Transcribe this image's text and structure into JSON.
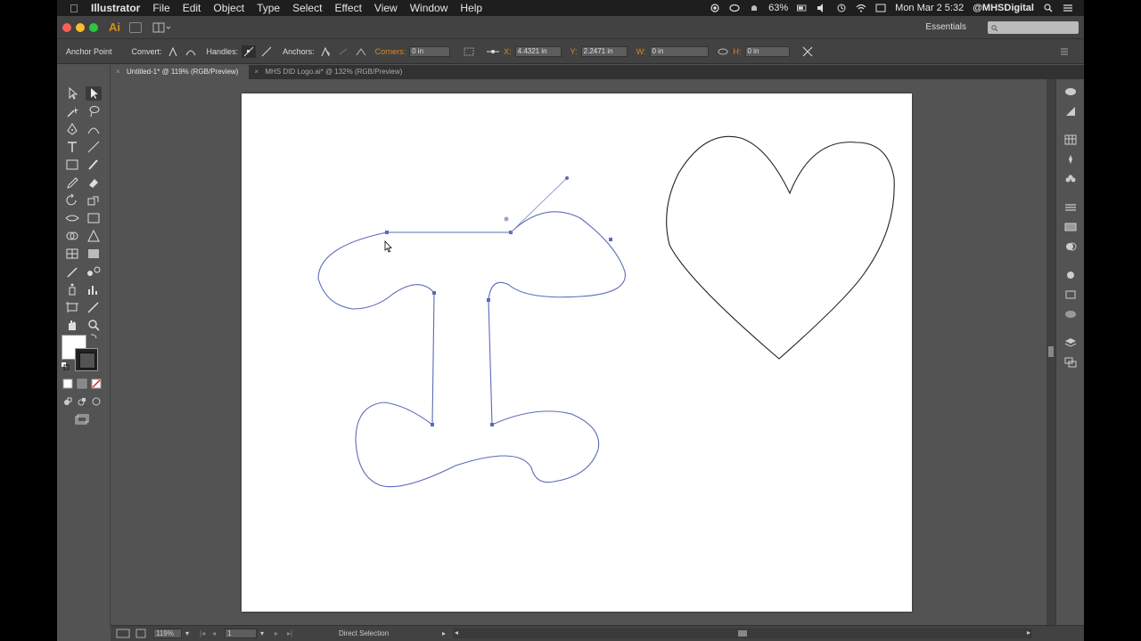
{
  "menubar": {
    "app_name": "Illustrator",
    "items": [
      "File",
      "Edit",
      "Object",
      "Type",
      "Select",
      "Effect",
      "View",
      "Window",
      "Help"
    ],
    "battery": "63%",
    "clock": "Mon Mar 2  5:32",
    "user": "@MHSDigital"
  },
  "appbar": {
    "logo": "Ai",
    "workspace": "Essentials",
    "search_placeholder": "",
    "colors": {
      "close": "#fc5f57",
      "minimize": "#fdbc2e",
      "zoom": "#28c840"
    }
  },
  "control": {
    "tool_label": "Anchor Point",
    "convert_label": "Convert:",
    "handles_label": "Handles:",
    "anchors_label": "Anchors:",
    "corners_label": "Corners:",
    "corners_value": "0 in",
    "x_label": "X:",
    "x_value": "4.4321 in",
    "y_label": "Y:",
    "y_value": "2.2471 in",
    "w_label": "W:",
    "w_value": "0 in",
    "h_label": "H:",
    "h_value": "0 in"
  },
  "tabs": [
    {
      "label": "Untitled-1* @ 119% (RGB/Preview)",
      "active": true
    },
    {
      "label": "MHS DID Logo.ai* @ 132% (RGB/Preview)",
      "active": false
    }
  ],
  "status": {
    "zoom": "119%",
    "page": "1",
    "tool": "Direct Selection"
  },
  "artboard": {
    "heart_stroke": "#222222",
    "letter_stroke": "#5b6bb8"
  }
}
